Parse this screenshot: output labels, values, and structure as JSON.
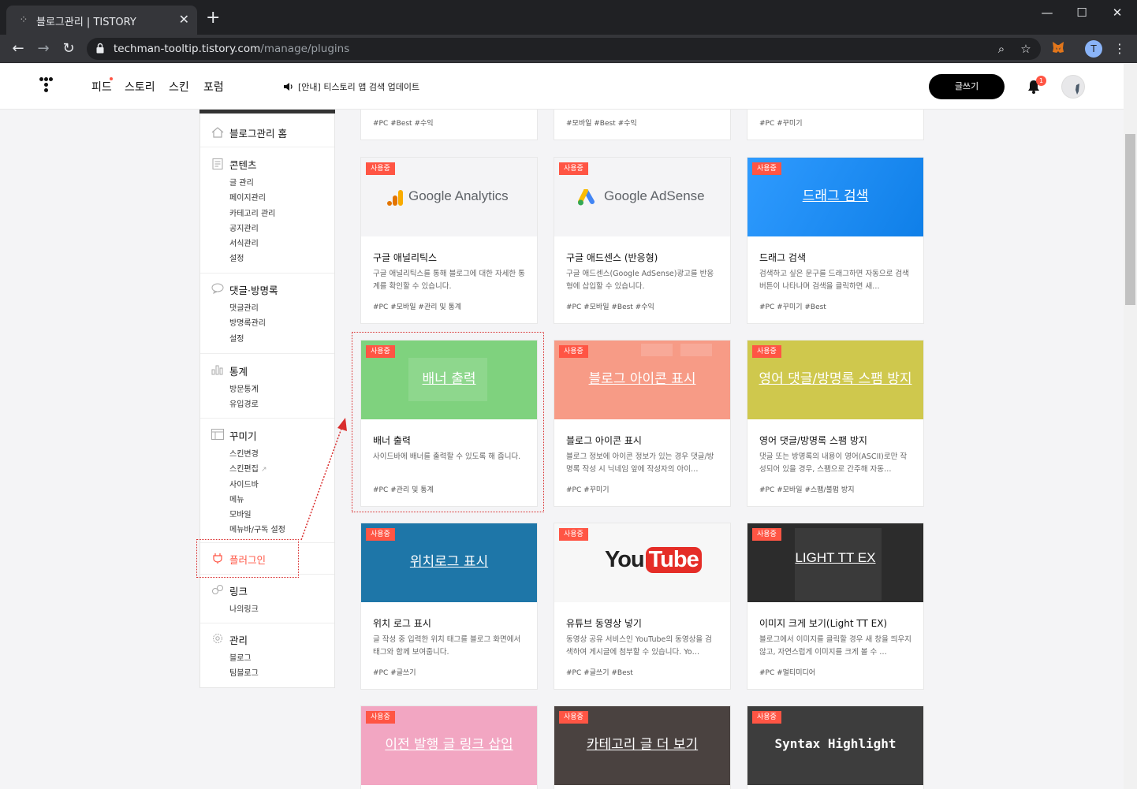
{
  "browser": {
    "tab_title": "블로그관리 | TISTORY",
    "url_host": "techman-tooltip.tistory.com",
    "url_path": "/manage/plugins",
    "profile_initial": "T"
  },
  "header": {
    "nav": [
      "피드",
      "스토리",
      "스킨",
      "포럼"
    ],
    "notice": "[안내] 티스토리 앱 검색 업데이트",
    "write_label": "글쓰기",
    "notification_count": "1"
  },
  "sidebar": {
    "home": "블로그관리 홈",
    "contents": {
      "title": "콘텐츠",
      "items": [
        "글 관리",
        "페이지관리",
        "카테고리 관리",
        "공지관리",
        "서식관리",
        "설정"
      ]
    },
    "comments": {
      "title": "댓글·방명록",
      "items": [
        "댓글관리",
        "방명록관리",
        "설정"
      ]
    },
    "stats": {
      "title": "통계",
      "items": [
        "방문통계",
        "유입경로"
      ]
    },
    "design": {
      "title": "꾸미기",
      "items": [
        "스킨변경",
        "스킨편집",
        "사이드바",
        "메뉴",
        "모바일",
        "메뉴바/구독 설정"
      ]
    },
    "plugin": {
      "title": "플러그인"
    },
    "link": {
      "title": "링크",
      "items": [
        "나의링크"
      ]
    },
    "manage": {
      "title": "관리",
      "items": [
        "블로그",
        "팀블로그"
      ]
    }
  },
  "top_row_tags": [
    "#PC  #Best  #수익",
    "#모바일  #Best  #수익",
    "#PC  #꾸미기"
  ],
  "badge_label": "사용중",
  "cards": [
    {
      "name": "구글 애널리틱스",
      "thumb": "Google Analytics",
      "desc": "구글 애널리틱스를 통해 블로그에 대한 자세한 통계를 확인할 수 있습니다.",
      "tags": "#PC  #모바일  #관리 및 통계",
      "bg": "#f4f4f6"
    },
    {
      "name": "구글 애드센스 (반응형)",
      "thumb": "Google AdSense",
      "desc": "구글 애드센스(Google AdSense)광고를 반응형에 삽입할 수 있습니다.",
      "tags": "#PC  #모바일  #Best  #수익",
      "bg": "#f4f4f6"
    },
    {
      "name": "드래그 검색",
      "thumb": "드래그 검색",
      "desc": "검색하고 싶은 문구를 드래그하면 자동으로 검색 버튼이 나타나며 검색을 클릭하면 새…",
      "tags": "#PC  #꾸미기  #Best",
      "bg": "#1b8ef5"
    },
    {
      "name": "배너 출력",
      "thumb": "배너 출력",
      "desc": "사이드바에 배너를 출력할 수 있도록 해 줍니다.",
      "tags": "#PC  #관리 및 통계",
      "bg": "#7fd27e"
    },
    {
      "name": "블로그 아이콘 표시",
      "thumb": "블로그 아이콘 표시",
      "desc": "블로그 정보에 아이콘 정보가 있는 경우 댓글/방명록 작성 시 닉네임 앞에 작성자의 아이…",
      "tags": "#PC  #꾸미기",
      "bg": "#f79b86"
    },
    {
      "name": "영어 댓글/방명록 스팸 방지",
      "thumb": "영어 댓글/방명록 스팸 방지",
      "desc": "댓글 또는 방명록의 내용이 영어(ASCII)로만 작성되어 있을 경우, 스팸으로 간주해 자동…",
      "tags": "#PC  #모바일  #스팸/불펌 방지",
      "bg": "#cfc84d"
    },
    {
      "name": "위치 로그 표시",
      "thumb": "위치로그 표시",
      "desc": "글 작성 중 입력한 위치 태그를 블로그 화면에서 태그와 함께 보여줍니다.",
      "tags": "#PC  #글쓰기",
      "bg": "#1e76a8"
    },
    {
      "name": "유튜브 동영상 넣기",
      "thumb": "YouTube",
      "desc": "동영상 공유 서비스인 YouTube의 동영상을 검색하여 게시글에 첨부할 수 있습니다. Yo…",
      "tags": "#PC  #글쓰기  #Best",
      "bg": "#f7f7f7"
    },
    {
      "name": "이미지 크게 보기(Light TT EX)",
      "thumb": "LIGHT TT EX",
      "desc": "블로그에서 이미지를 클릭할 경우 새 창을 띄우지 않고, 자연스럽게 이미지를 크게 볼 수 …",
      "tags": "#PC  #멀티미디어",
      "bg": "#2c2c2c"
    },
    {
      "name": "",
      "thumb": "이전 발행 글 링크 삽입",
      "desc": "",
      "tags": "",
      "bg": "#f2a6c2"
    },
    {
      "name": "",
      "thumb": "카테고리 글 더 보기",
      "desc": "",
      "tags": "",
      "bg": "#4a4240"
    },
    {
      "name": "",
      "thumb": "Syntax Highlight",
      "desc": "",
      "tags": "",
      "bg": "#3d3d3d"
    }
  ],
  "colors": {
    "accent": "#ff5544",
    "annotation": "#d92d2d"
  }
}
